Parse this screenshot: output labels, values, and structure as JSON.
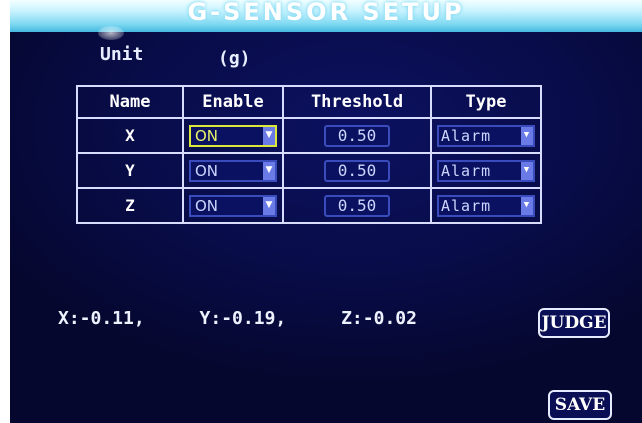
{
  "title": "G-SENSOR SETUP",
  "unit": {
    "label": "Unit",
    "value": "(g)"
  },
  "table": {
    "headers": [
      "Name",
      "Enable",
      "Threshold",
      "Type"
    ],
    "rows": [
      {
        "name": "X",
        "enable": "ON",
        "threshold": "0.50",
        "type": "Alarm"
      },
      {
        "name": "Y",
        "enable": "ON",
        "threshold": "0.50",
        "type": "Alarm"
      },
      {
        "name": "Z",
        "enable": "ON",
        "threshold": "0.50",
        "type": "Alarm"
      }
    ]
  },
  "readout": {
    "x": "X:-0.11,",
    "y": "Y:-0.19,",
    "z": "Z:-0.02"
  },
  "buttons": {
    "judge": "JUDGE",
    "save": "SAVE"
  },
  "colors": {
    "title_bar": "#7fd9f2",
    "background": "#080c48",
    "focus": "#d9e83a",
    "border": "#d8dcff"
  }
}
